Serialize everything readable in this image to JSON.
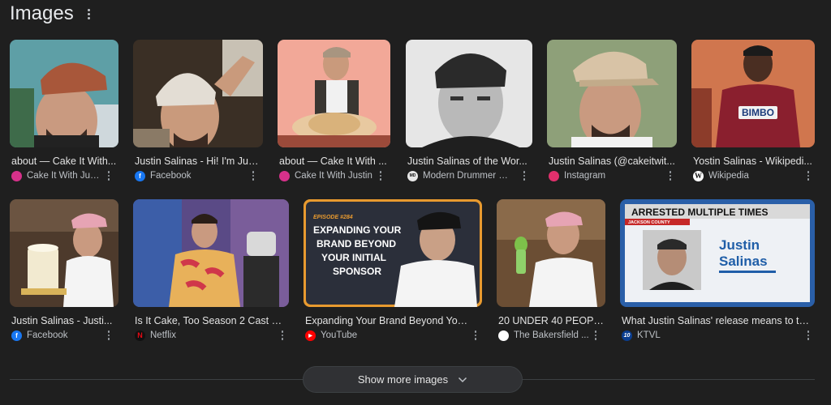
{
  "section": {
    "title": "Images",
    "show_more_label": "Show more images"
  },
  "row1": [
    {
      "caption": "about — Cake It With...",
      "source": "Cake It With Jus...",
      "favicon_color": "#d6318a"
    },
    {
      "caption": "Justin Salinas - Hi! I'm Jus...",
      "source": "Facebook",
      "favicon_color": "#1877f2"
    },
    {
      "caption": "about — Cake It With ...",
      "source": "Cake It With Justin",
      "favicon_color": "#d6318a"
    },
    {
      "caption": "Justin Salinas of the Wor...",
      "source": "Modern Drummer M...",
      "favicon_color": "#e8e8e8"
    },
    {
      "caption": "Justin Salinas (@cakeitwit...",
      "source": "Instagram",
      "favicon_color": "#e1306c"
    },
    {
      "caption": "Yostin Salinas - Wikipedi...",
      "source": "Wikipedia",
      "favicon_color": "#ffffff"
    }
  ],
  "row2": [
    {
      "caption": "Justin Salinas - Justi...",
      "source": "Facebook",
      "favicon_color": "#1877f2"
    },
    {
      "caption": "Is It Cake, Too Season 2 Cast & I...",
      "source": "Netflix",
      "favicon_color": "#e50914"
    },
    {
      "caption": "Expanding Your Brand Beyond Your I...",
      "source": "YouTube",
      "favicon_color": "#ff0000"
    },
    {
      "caption": "20 UNDER 40 PEOPL...",
      "source": "The Bakersfield ...",
      "favicon_color": "#ffffff"
    },
    {
      "caption": "What Justin Salinas' release means to th...",
      "source": "KTVL",
      "favicon_color": "#0a3d8f"
    }
  ],
  "thumb_text": {
    "youtube_episode": "EPISODE #284",
    "youtube_line1": "EXPANDING YOUR",
    "youtube_line2": "BRAND BEYOND",
    "youtube_line3": "YOUR INITIAL",
    "youtube_line4": "SPONSOR",
    "ktvl_banner": "ARRESTED MULTIPLE TIMES",
    "ktvl_county": "JACKSON COUNTY",
    "ktvl_name1": "Justin",
    "ktvl_name2": "Salinas",
    "jersey": "BIMBO",
    "favicon_10": "10"
  }
}
